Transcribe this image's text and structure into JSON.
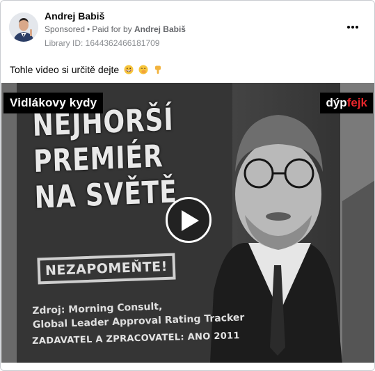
{
  "post": {
    "author": "Andrej Babiš",
    "sponsored": "Sponsored",
    "paid_for_by_prefix": "Paid for by",
    "paid_for_by": "Andrej Babiš",
    "library_id": "Library ID: 1644362466181709",
    "text": "Tohle video si určitě dejte",
    "emojis": [
      "smiling-face-with-grin-emoji",
      "face-with-hand-over-mouth-emoji",
      "backhand-index-pointing-down-emoji"
    ]
  },
  "media": {
    "label_left": "Vidlákovy kydy",
    "label_right_part1": "dýp",
    "label_right_part2": "fejk",
    "headline_line1": "NEJHORŠÍ",
    "headline_line2": "PREMIÉR",
    "headline_line3": "NA SVĚTĚ",
    "stamp": "NEZAPOMEŇTE!",
    "source_line1": "Zdroj: Morning Consult,",
    "source_line2": "Global Leader Approval Rating Tracker",
    "publisher": "ZADAVATEL A ZPRACOVATEL: ANO 2011"
  },
  "colors": {
    "accent_red": "#e8262b",
    "meta_gray": "#65676b"
  }
}
